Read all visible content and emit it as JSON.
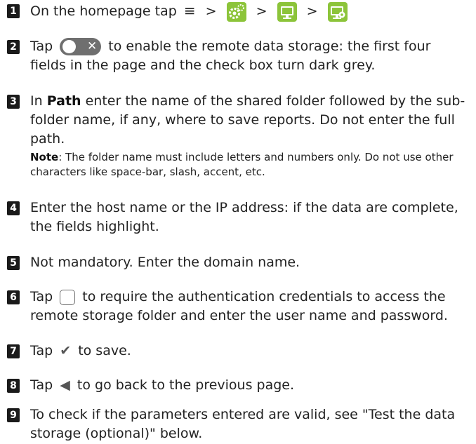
{
  "steps": [
    {
      "num": "1",
      "text_a": "On the homepage tap",
      "menu_glyph": "≡",
      "sep": ">"
    },
    {
      "num": "2",
      "text_a": "Tap",
      "text_b": "to enable the remote data storage: the first four fields in the page and the check box turn dark grey.",
      "toggle_x": "✕"
    },
    {
      "num": "3",
      "text_a": "In",
      "bold": "Path",
      "text_b": "enter the name of the shared folder followed by the sub-folder name, if any, where to save reports. Do not enter the full path.",
      "note_label": "Note",
      "note_text": ": The folder name must include letters and numbers only. Do not use other characters like space-bar, slash, accent, etc."
    },
    {
      "num": "4",
      "text": "Enter the host name or the IP address: if the data are complete, the fields highlight."
    },
    {
      "num": "5",
      "text": "Not mandatory. Enter the domain name."
    },
    {
      "num": "6",
      "text_a": "Tap",
      "text_b": "to require the authentication credentials to access the remote storage folder and enter the user name and password."
    },
    {
      "num": "7",
      "text_a": "Tap",
      "glyph": "✔",
      "text_b": "to save."
    },
    {
      "num": "8",
      "text_a": "Tap",
      "glyph": "◀",
      "text_b": "to go back to the previous page."
    },
    {
      "num": "9",
      "text": "To check if the parameters entered are valid, see \"Test the data storage (optional)\" below."
    }
  ],
  "icons": {
    "settings_tile": "gear-cog-icon",
    "storage_tile": "monitor-storage-icon",
    "remote_tile": "monitor-gear-icon",
    "tile_color": "#8cc43a",
    "toggle_color": "#6f6f6f"
  }
}
